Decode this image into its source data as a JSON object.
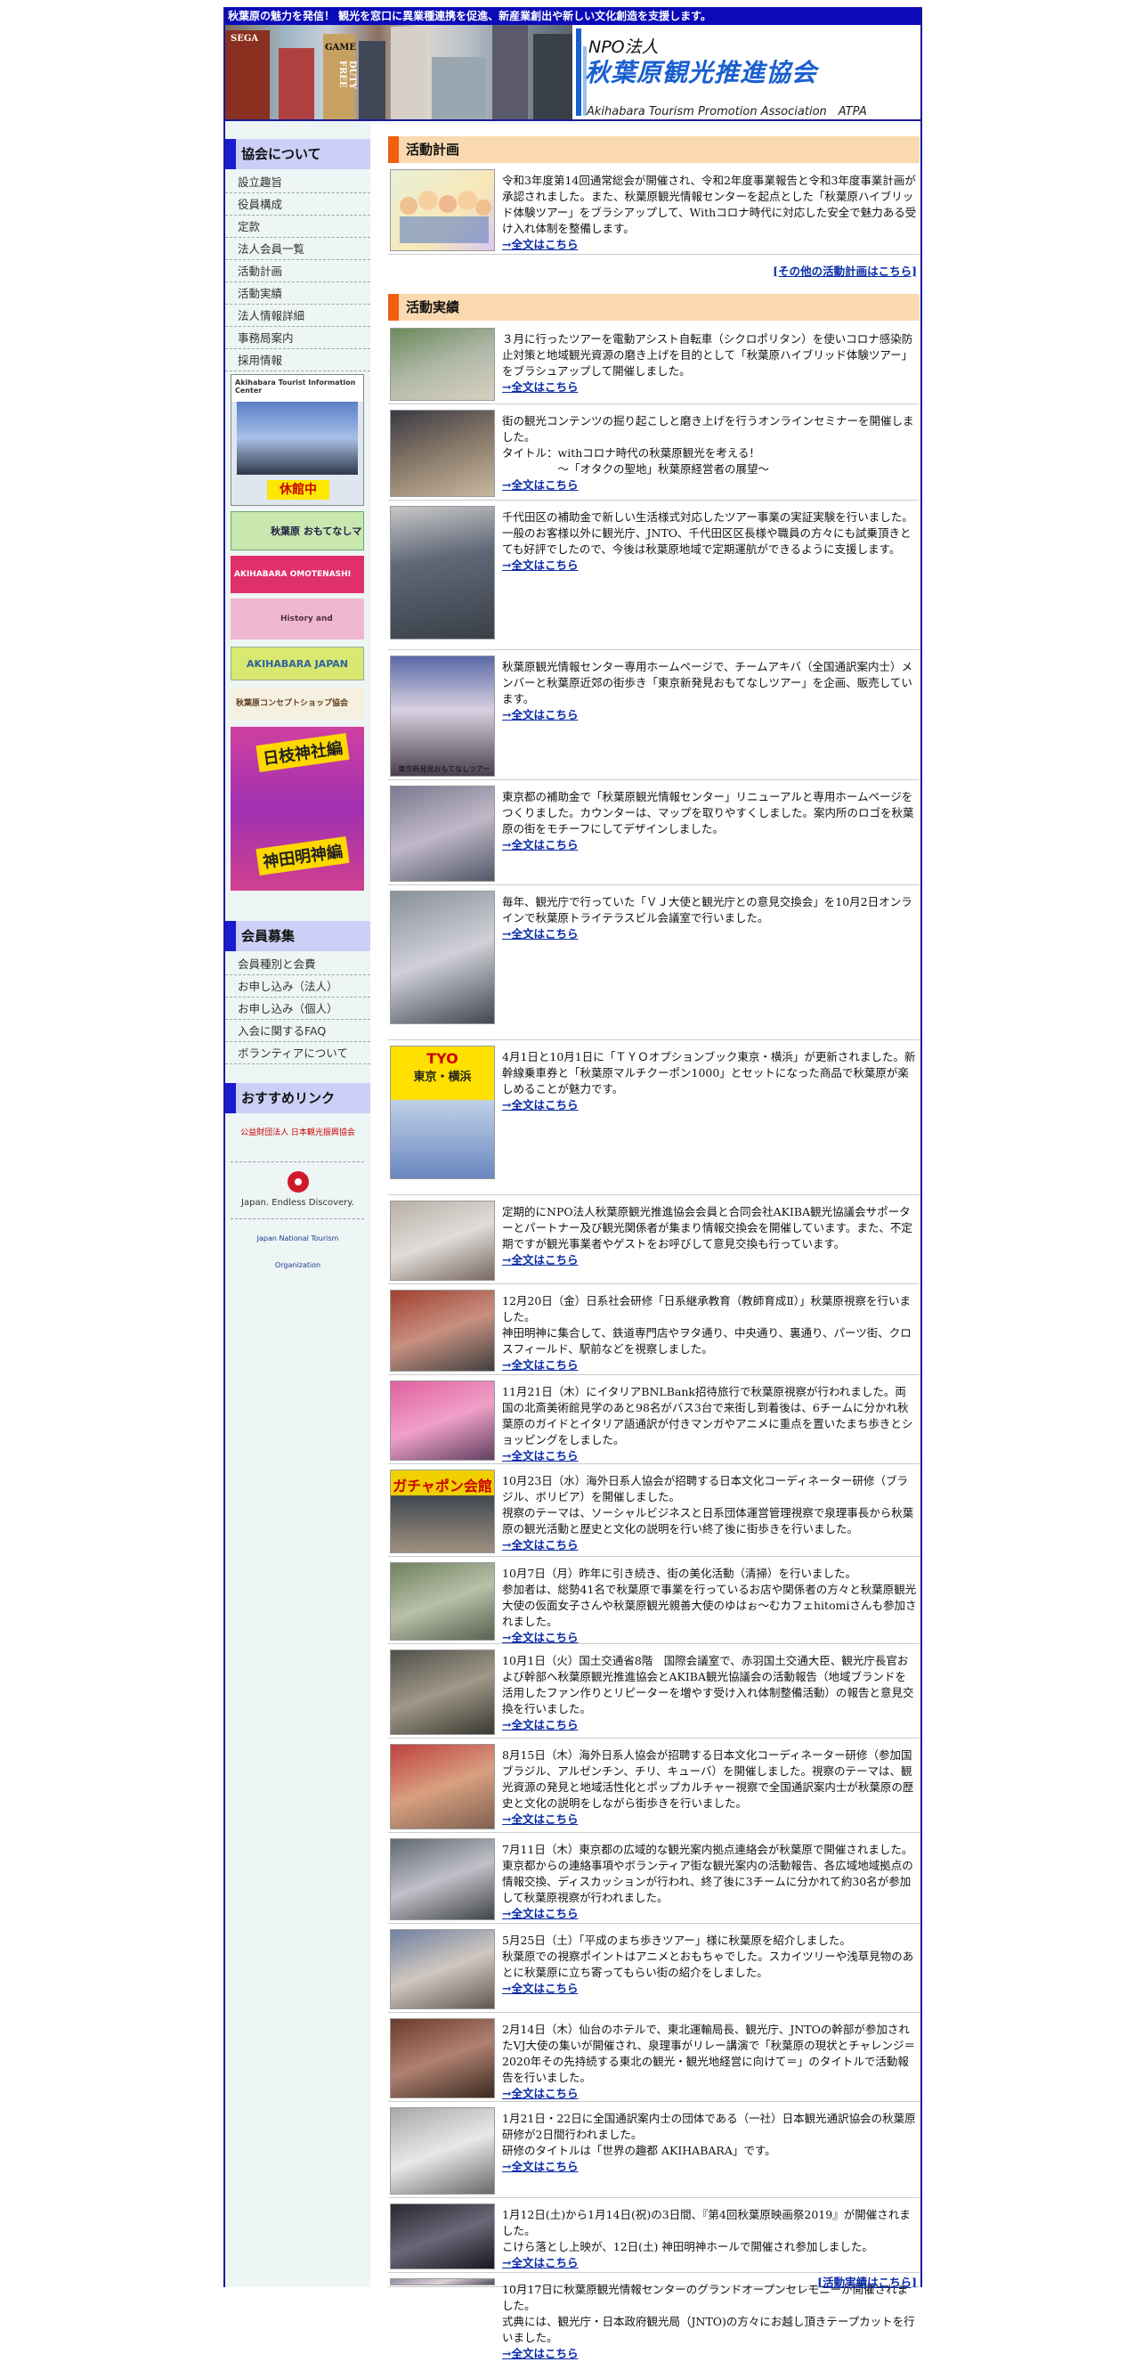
{
  "topbar": {
    "text": "秋葉原の魅力を発信！ 観光を窓口に異業種連携を促進、新産業創出や新しい文化創造を支援します。"
  },
  "header": {
    "npo": "NPO法人",
    "name": "秋葉原観光推進協会",
    "english": "Akihabara Tourism Promotion Association　ATPA",
    "photo_signs": [
      "SEGA",
      "GAME",
      "DUTY FREE"
    ]
  },
  "sidebar": {
    "about_title": "協会について",
    "about_items": [
      "設立趣旨",
      "役員構成",
      "定款",
      "法人会員一覧",
      "活動計画",
      "活動実績",
      "法人情報詳細",
      "事務局案内",
      "採用情報"
    ],
    "tic_banner": {
      "caption": "Akihabara Tourist Information Center",
      "badge": "休館中"
    },
    "banners": [
      "秋葉原 おもてなしマップ",
      "AKIHABARA OMOTENASHI PROJECT",
      "History and Culture Course",
      "AKIHABARA JAPAN",
      "秋葉原コンセプトショップ協会",
      "日枝神社編",
      "神田明神編"
    ],
    "members_title": "会員募集",
    "member_items": [
      "会員種別と会費",
      "お申し込み（法人）",
      "お申し込み（個人）",
      "入会に関するFAQ",
      "ボランティアについて"
    ],
    "links_title": "おすすめリンク",
    "links": [
      "公益財団法人 日本観光振興協会",
      "Japan. Endless Discovery.",
      "Japan National Tourism Organization"
    ]
  },
  "plan": {
    "title": "活動計画",
    "text": "令和3年度第14回通常総会が開催され、令和2年度事業報告と令和3年度事業計画が承認されました。また、秋葉原観光情報センターを起点とした「秋葉原ハイブリッド体験ツアー」をブラシアップして、Withコロナ時代に対応した安全で魅力ある受け入れ体制を整備します。",
    "more": "→全文はこちら",
    "other": "[その他の活動計画はこちら]"
  },
  "results": {
    "title": "活動実績",
    "more": "→全文はこちら",
    "entries": [
      {
        "text": "３月に行ったツアーを電動アシスト自転車（シクロポリタン）を使いコロナ感染防止対策と地域観光資源の磨き上げを目的として「秋葉原ハイブリッド体験ツアー」をブラシュアップして開催しました。"
      },
      {
        "text": "街の観光コンテンツの掘り起こしと磨き上げを行うオンラインセミナーを開催しました。\nタイトル：withコロナ時代の秋葉原観光を考える！\n　　　　　～「オタクの聖地」秋葉原経営者の展望～"
      },
      {
        "text": "千代田区の補助金で新しい生活様式対応したツアー事業の実証実験を行いました。\n一般のお客様以外に観光庁、JNTO、千代田区区長様や職員の方々にも試乗頂きとても好評でしたので、今後は秋葉原地域で定期運航ができるように支援します。"
      },
      {
        "text": "秋葉原観光情報センター専用ホームページで、チームアキバ（全国通訳案内士）メンバーと秋葉原近郊の街歩き「東京新発見おもてなしツアー」を企画、販売しています。",
        "caption": "東京新発見おもてなしツアー"
      },
      {
        "text": "東京都の補助金で「秋葉原観光情報センター」リニューアルと専用ホームページをつくりました。カウンターは、マップを取りやすくしました。案内所のロゴを秋葉原の街をモチーフにしてデザインしました。"
      },
      {
        "text": "毎年、観光庁で行っていた「ＶＪ大使と観光庁との意見交換会」を10月2日オンラインで秋葉原トライテラスビル会議室で行いました。"
      },
      {
        "text": "4月1日と10月1日に「ＴＹＯオプションブック東京・横浜」が更新されました。新幹線乗車券と「秋葉原マルチクーポン1000」とセットになった商品で秋葉原が楽しめることが魅力です。",
        "thumb_title": "TYO",
        "thumb_sub": "東京・横浜"
      },
      {
        "text": "定期的にNPO法人秋葉原観光推進協会会員と合同会社AKIBA観光協議会サポーターとパートナー及び観光関係者が集まり情報交換会を開催しています。また、不定期ですが観光事業者やゲストをお呼びして意見交換も行っています。"
      },
      {
        "text": "12月20日（金）日系社会研修「日系継承教育（教師育成Ⅱ）」秋葉原視察を行いました。\n神田明神に集合して、鉄道専門店やヲタ通り、中央通り、裏通り、パーツ街、クロスフィールド、駅前などを視察しました。"
      },
      {
        "text": "11月21日（木）にイタリアBNLBank招待旅行で秋葉原視察が行われました。両国の北斎美術館見学のあと98名がバス3台で来街し到着後は、6チームに分かれ秋葉原のガイドとイタリア語通訳が付きマンガやアニメに重点を置いたまち歩きとショッピングをしました。"
      },
      {
        "text": "10月23日（水）海外日系人協会が招聘する日本文化コーディネーター研修（ブラジル、ボリビア）を開催しました。\n視察のテーマは、ソーシャルビジネスと日系団体運営管理視察で泉理事長から秋葉原の観光活動と歴史と文化の説明を行い終了後に街歩きを行いました。",
        "thumb_title": "ガチャポン会館"
      },
      {
        "text": "10月7日（月）昨年に引き続き、街の美化活動（清掃）を行いました。\n参加者は、総勢41名で秋葉原で事業を行っているお店や関係者の方々と秋葉原観光大使の仮面女子さんや秋葉原観光親善大使のゆはぉ～むカフェhitomiさんも参加されました。"
      },
      {
        "text": "10月1日（火）国土交通省8階　国際会議室で、赤羽国土交通大臣、観光庁長官および幹部へ秋葉原観光推進協会とAKIBA観光協議会の活動報告（地域ブランドを活用したファン作りとリピーターを増やす受け入れ体制整備活動）の報告と意見交換を行いました。"
      },
      {
        "text": "8月15日（木）海外日系人協会が招聘する日本文化コーディネーター研修（参加国ブラジル、アルゼンチン、チリ、キューバ）を開催しました。視察のテーマは、観光資源の発見と地域活性化とポップカルチャー視察で全国通訳案内士が秋葉原の歴史と文化の説明をしながら街歩きを行いました。"
      },
      {
        "text": "7月11日（木）東京都の広域的な観光案内拠点連絡会が秋葉原で開催されました。東京都からの連絡事項やボランティア街な観光案内の活動報告、各広域地域拠点の情報交換、ディスカッションが行われ、終了後に3チームに分かれて約30名が参加して秋葉原視察が行われました。"
      },
      {
        "text": "5月25日（土）「平成のまち歩きツアー」様に秋葉原を紹介しました。\n秋葉原での視察ポイントはアニメとおもちゃでした。スカイツリーや浅草見物のあとに秋葉原に立ち寄ってもらい街の紹介をしました。"
      },
      {
        "text": "2月14日（木）仙台のホテルで、東北運輸局長、観光庁、JNTOの幹部が参加されたVJ大使の集いが開催され、泉理事がリレー講演で「秋葉原の現状とチャレンジ＝2020年その先持続する東北の観光・観光地経営に向けて＝」のタイトルで活動報告を行いました。"
      },
      {
        "text": "1月21日・22日に全国通訳案内士の団体である（一社）日本観光通訳協会の秋葉原研修が2日間行われました。\n研修のタイトルは「世界の趣都 AKIHABARA」です。"
      },
      {
        "text": "1月12日(土)から1月14日(祝)の3日間、『第4回秋葉原映画祭2019』が開催されました。\nこけら落とし上映が、12日(土) 神田明神ホールで開催され参加しました。"
      },
      {
        "text": "10月17日に秋葉原観光情報センターのグランドオープンセレモニーが開催されました。\n式典には、観光庁・日本政府観光局（JNTO)の方々にお越し頂きテープカットを行いました。"
      }
    ],
    "other": "[活動実績はこちら]"
  },
  "colors": {
    "topbar": "#0a0ab8",
    "accent_blue": "#1a1ad0",
    "accent_orange": "#f06010",
    "link": "#0b2ca8"
  }
}
